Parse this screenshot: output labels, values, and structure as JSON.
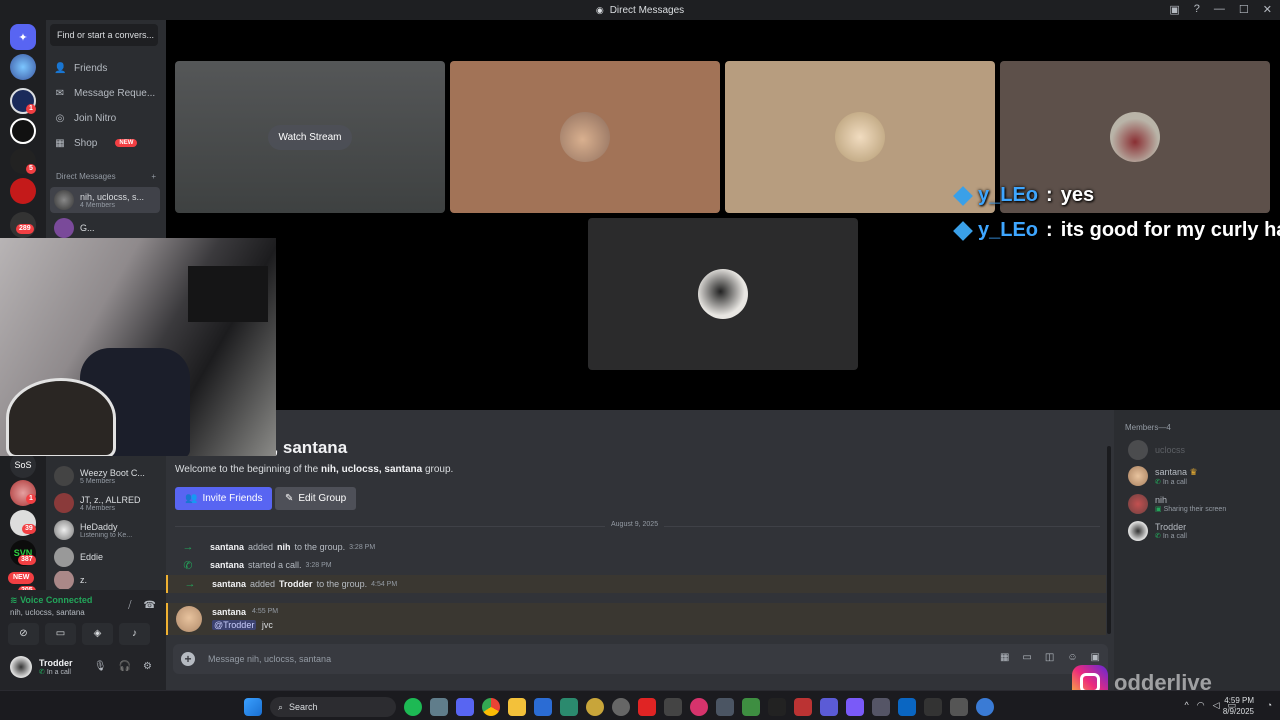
{
  "window": {
    "title": "Direct Messages",
    "controls": {
      "inbox": "▣",
      "help": "?",
      "minimize": "—",
      "maximize": "☐",
      "close": "✕"
    }
  },
  "servers": {
    "badges": [
      "1",
      "5",
      "289",
      "1",
      "39",
      "387",
      "205"
    ],
    "labels": {
      "sos": "SoS",
      "svn": "SVN",
      "new": "NEW"
    }
  },
  "sidebar": {
    "search_label": "Find or start a convers...",
    "nav": [
      {
        "label": "Friends",
        "icon": "friends-icon"
      },
      {
        "label": "Message Reque...",
        "icon": "mail-icon"
      },
      {
        "label": "Join Nitro",
        "icon": "nitro-icon"
      },
      {
        "label": "Shop",
        "icon": "shop-icon",
        "badge": "NEW"
      }
    ],
    "dm_header": "Direct Messages",
    "dm_add": "+",
    "dms": [
      {
        "name": "nih, uclocss, s...",
        "sub": "4 Members"
      },
      {
        "name": "G...",
        "sub": ""
      },
      {
        "name": "Weezy Boot C...",
        "sub": "5 Members"
      },
      {
        "name": "JT, z., ALLRED",
        "sub": "4 Members"
      },
      {
        "name": "HeDaddy",
        "sub": "Listening to Ke..."
      },
      {
        "name": "Eddie",
        "sub": ""
      },
      {
        "name": "z.",
        "sub": ""
      }
    ]
  },
  "stage": {
    "watch_stream": "Watch Stream"
  },
  "overlay": {
    "messages": [
      {
        "user": "y_LEo",
        "sep": ":",
        "text": "yes"
      },
      {
        "user": "y_LEo",
        "sep": ":",
        "text": "its good for my curly hai"
      }
    ]
  },
  "chat": {
    "group_title": "s, santana",
    "welcome_prefix": "Welcome to the beginning of the",
    "welcome_group": "nih, uclocss, santana",
    "welcome_suffix": "group.",
    "invite_label": "Invite Friends",
    "edit_label": "Edit Group",
    "date": "August 9, 2025",
    "system": [
      {
        "icon": "→",
        "user": "santana",
        "action": "added",
        "target": "nih",
        "rest": "to the group.",
        "time": "3:28 PM"
      },
      {
        "icon": "✆",
        "user": "santana",
        "action": "started a call.",
        "target": "",
        "rest": "",
        "time": "3:28 PM"
      },
      {
        "icon": "→",
        "user": "santana",
        "action": "added",
        "target": "Trodder",
        "rest": "to the group.",
        "time": "4:54 PM"
      }
    ],
    "message": {
      "user": "santana",
      "time": "4:55 PM",
      "mention": "@Trodder",
      "text": "jvc"
    },
    "composer_placeholder": "Message nih, uclocss, santana",
    "composer_tools": [
      "▦",
      "▭",
      "◫",
      "☺",
      "▣"
    ]
  },
  "members": {
    "header": "Members—4",
    "list": [
      {
        "name": "uclocss",
        "status": ""
      },
      {
        "name": "santana",
        "crown": "♛",
        "status": "In a call"
      },
      {
        "name": "nih",
        "status": "Sharing their screen"
      },
      {
        "name": "Trodder",
        "status": "In a call"
      }
    ]
  },
  "voice": {
    "status": "Voice Connected",
    "channel": "nih, uclocss, santana"
  },
  "user": {
    "name": "Trodder",
    "status": "In a call"
  },
  "watermark": {
    "text": "odderlive"
  },
  "taskbar": {
    "search": "Search",
    "time": "4:59 PM",
    "date": "8/9/2025",
    "tray": "^"
  },
  "colors": {
    "accent": "#5865f2",
    "online": "#23a55a",
    "badge": "#f23f43",
    "highlight": "#f0b232"
  }
}
